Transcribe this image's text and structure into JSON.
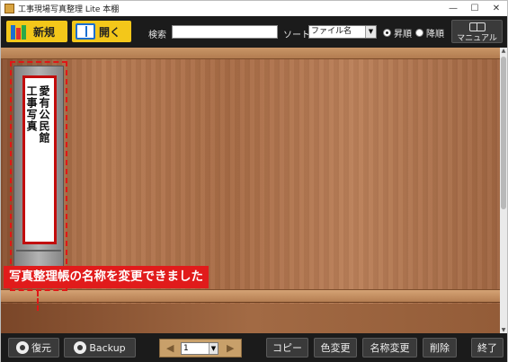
{
  "window": {
    "title": "工事現場写真整理 Lite 本棚",
    "controls": [
      "—",
      "☐",
      "✕"
    ]
  },
  "toolbar": {
    "new_label": "新規",
    "open_label": "開く",
    "search_label": "検索",
    "search_value": "",
    "sort_label": "ソート",
    "sort_value": "ファイル名",
    "ascending_label": "昇順",
    "descending_label": "降順",
    "ascending_selected": true,
    "manual_label": "マニュアル"
  },
  "shelf": {
    "binder_title_col1": "愛有公民館",
    "binder_title_col2": "工事写真",
    "selected": true
  },
  "notice": "写真整理帳の名称を変更できました",
  "bottom": {
    "restore_label": "復元",
    "backup_label": "Backup",
    "page_value": "1",
    "copy_label": "コピー",
    "color_label": "色変更",
    "rename_label": "名称変更",
    "delete_label": "削除",
    "exit_label": "終了"
  },
  "colors": {
    "accent_yellow": "#f3c71a",
    "highlight_red": "#e11b1b",
    "toolbar_bg": "#1b1b1b"
  }
}
